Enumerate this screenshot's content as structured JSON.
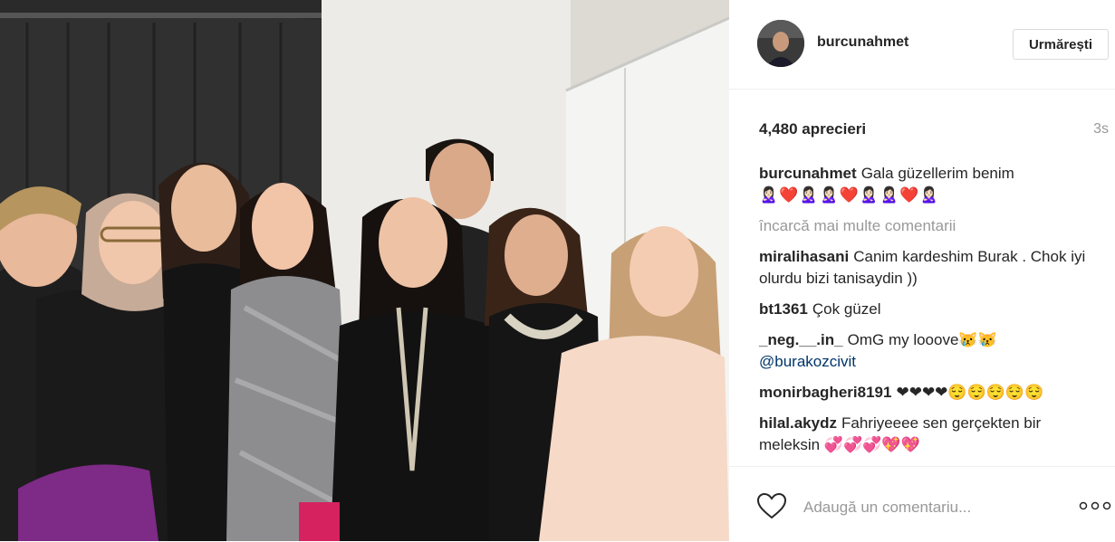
{
  "post": {
    "username": "burcunahmet",
    "follow_label": "Urmărești",
    "likes": "4,480 aprecieri",
    "time": "3s",
    "caption_user": "burcunahmet",
    "caption_text": "Gala güzellerim benim",
    "caption_emojis": "🙎🏻‍♀️❤️🙎🏻‍♀️🙎🏻‍♀️❤️🙎🏻‍♀️🙎🏻‍♀️❤️🙎🏻‍♀️",
    "load_more": "încarcă mai multe comentarii"
  },
  "comments": [
    {
      "user": "miralihasani",
      "text": "Canim kardeshim Burak . Chok iyi olurdu bizi tanisaydin ))"
    },
    {
      "user": "bt1361",
      "text": "Çok güzel"
    },
    {
      "user": "_neg.__.in_",
      "text": "OmG my looove😿😿",
      "mention": "@burakozcivit"
    },
    {
      "user": "monirbagheri8191",
      "text": "❤❤❤❤😌😌😌😌😌"
    },
    {
      "user": "hilal.akydz",
      "text": "Fahriyeeee sen gerçekten bir meleksin 💞💞💞💖💖"
    }
  ],
  "footer": {
    "comment_placeholder": "Adaugă un comentariu...",
    "like_icon": "heart-outline-icon",
    "more_icon": "more-dots-icon"
  },
  "colors": {
    "text": "#262626",
    "muted": "#999999",
    "mention": "#003569",
    "border": "#dbdbdb"
  }
}
